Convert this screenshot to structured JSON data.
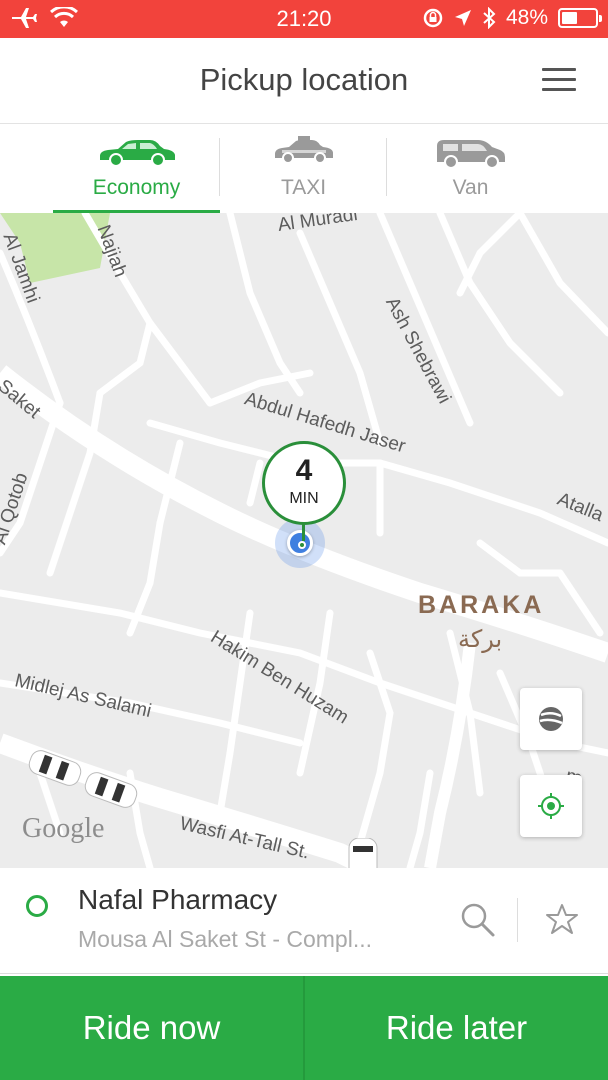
{
  "status_bar": {
    "time": "21:20",
    "battery_text": "48%",
    "battery_level": 0.48,
    "icons": [
      "airplane-icon",
      "wifi-icon",
      "orientation-lock-icon",
      "location-arrow-icon",
      "bluetooth-icon",
      "battery-icon"
    ]
  },
  "header": {
    "title": "Pickup location",
    "menu_icon": "hamburger-menu-icon"
  },
  "tabs": [
    {
      "label": "Economy",
      "icon": "car-icon",
      "active": true,
      "color": "#2aab45"
    },
    {
      "label": "TAXI",
      "icon": "taxi-icon",
      "active": false,
      "color": "#9a9a9a"
    },
    {
      "label": "Van",
      "icon": "van-icon",
      "active": false,
      "color": "#9a9a9a"
    }
  ],
  "map": {
    "streets": {
      "al_muradi": "Al Muradi",
      "najiah": "Najiah",
      "al_jamhi": "Al Jamhi",
      "ash_shebrawi": "Ash Shebrawi",
      "saket": "Saket",
      "abdul_hafedh": "Abdul Hafedh Jaser",
      "al_qotob": "Al Qotob",
      "atalla": "Atalla",
      "hakim": "Hakim Ben Huzam",
      "midlej": "Midlej As Salami",
      "wasfi": "Wasfi At-Tall St.",
      "partial": "m"
    },
    "district": "BARAKA",
    "district_arabic": "بركة",
    "eta_value": "4",
    "eta_unit": "MIN",
    "attribution": "Google",
    "buttons": [
      "globe-icon",
      "my-location-icon"
    ]
  },
  "pickup": {
    "name": "Nafal Pharmacy",
    "address": "Mousa Al Saket St - Compl...",
    "status_color": "#2aab45"
  },
  "actions": {
    "ride_now": "Ride now",
    "ride_later": "Ride later",
    "color": "#2aab45"
  }
}
